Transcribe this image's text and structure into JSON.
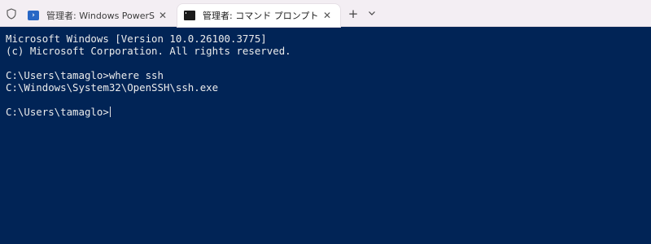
{
  "tabs": [
    {
      "title": "管理者: Windows PowerShell",
      "icon": "powershell-icon",
      "active": false,
      "close": "✕"
    },
    {
      "title": "管理者: コマンド プロンプト",
      "icon": "command-prompt-icon",
      "active": true,
      "close": "✕"
    }
  ],
  "tabbar": {
    "new_tab": "+",
    "dropdown": "⌄",
    "shield_icon": "shield-icon"
  },
  "terminal": {
    "lines": [
      "Microsoft Windows [Version 10.0.26100.3775]",
      "(c) Microsoft Corporation. All rights reserved.",
      "",
      "C:\\Users\\tamaglo>where ssh",
      "C:\\Windows\\System32\\OpenSSH\\ssh.exe",
      "",
      "C:\\Users\\tamaglo>"
    ],
    "background": "#012456",
    "foreground": "#ececec"
  },
  "colors": {
    "tabbar_bg": "#f3eef3",
    "active_tab_bg": "#ffffff",
    "powershell_blue": "#2867c5"
  }
}
